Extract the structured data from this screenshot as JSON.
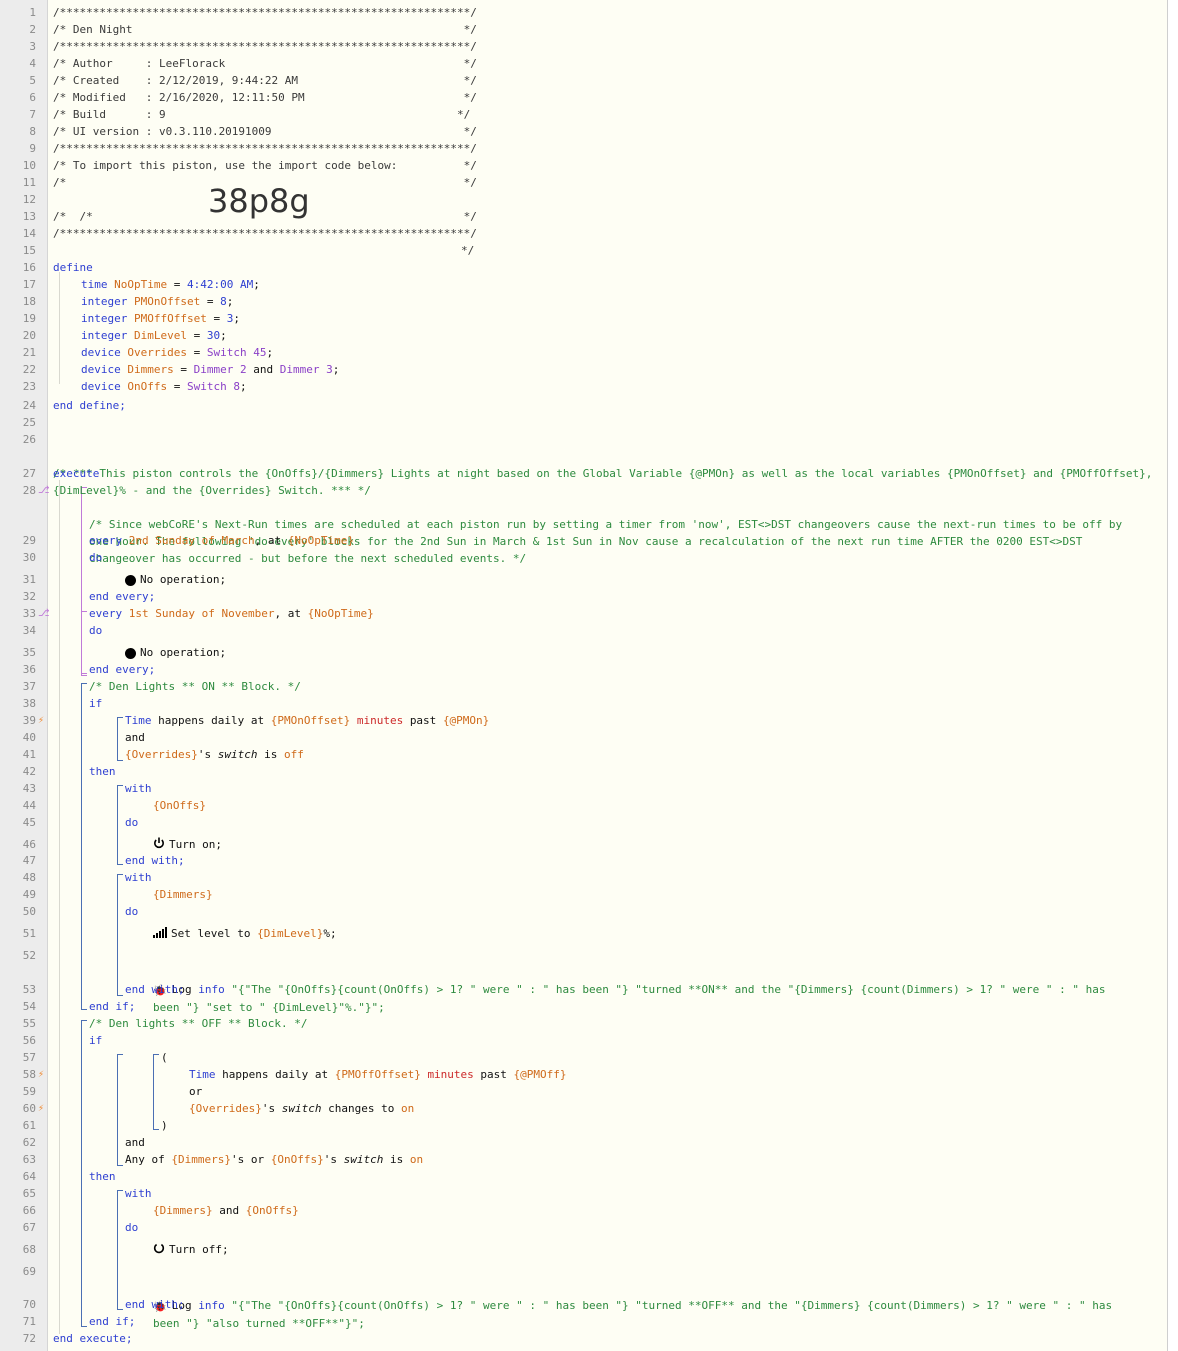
{
  "line_numbers": [
    "1",
    "2",
    "3",
    "4",
    "5",
    "6",
    "7",
    "8",
    "9",
    "10",
    "11",
    "12",
    "13",
    "14",
    "15",
    "16",
    "17",
    "18",
    "19",
    "20",
    "21",
    "22",
    "23",
    "24",
    "25",
    "26",
    "27",
    "28",
    "29",
    "30",
    "31",
    "32",
    "33",
    "34",
    "35",
    "36",
    "37",
    "38",
    "39",
    "40",
    "41",
    "42",
    "43",
    "44",
    "45",
    "46",
    "47",
    "48",
    "49",
    "50",
    "51",
    "52",
    "53",
    "54",
    "55",
    "56",
    "57",
    "58",
    "59",
    "60",
    "61",
    "62",
    "63",
    "64",
    "65",
    "66",
    "67",
    "68",
    "69",
    "70",
    "71",
    "72"
  ],
  "header": {
    "stars": "/**************************************************************/",
    "title_line": "/* Den Night                                                  */",
    "author_line": "/* Author     : LeeFlorack                                    */",
    "created_line": "/* Created    : 2/12/2019, 9:44:22 AM                         */",
    "modified_line": "/* Modified   : 2/16/2020, 12:11:50 PM                        */",
    "build_line": "/* Build      : 9                                            */",
    "ui_version_line": "/* UI version : v0.3.110.20191009                             */",
    "import_line": "/* To import this piston, use the import code below:          */",
    "blank_line": "/*                                                            */",
    "code_prefix": "/*",
    "code_suffix": "*/",
    "import_code": "38p8g"
  },
  "define": {
    "open": "define",
    "close": "end define;",
    "vars": [
      {
        "type": "time",
        "name": "NoOpTime",
        "value": "4:42:00 AM"
      },
      {
        "type": "integer",
        "name": "PMOnOffset",
        "value": "8"
      },
      {
        "type": "integer",
        "name": "PMOffOffset",
        "value": "3"
      },
      {
        "type": "integer",
        "name": "DimLevel",
        "value": "30"
      },
      {
        "type": "device",
        "name": "Overrides",
        "value": "Switch 45"
      },
      {
        "type": "device",
        "name": "Dimmers",
        "value": "Dimmer 2",
        "value2": "Dimmer 3"
      },
      {
        "type": "device",
        "name": "OnOffs",
        "value": "Switch 8"
      }
    ],
    "and_word": "and"
  },
  "comment_main": "/* *** This piston controls the {OnOffs}/{Dimmers} Lights at night based on the Global Variable {@PMOn} as well as the local variables {PMOnOffset} and {PMOffOffset}, {DimLevel}% - and the {Overrides} Switch. *** */",
  "execute": "execute",
  "end_execute": "end execute;",
  "comment_every": "/* Since webCoRE's Next-Run times are scheduled at each piston run by setting a timer from 'now', EST<>DST changeovers cause the next-run times to be off by one hour. The following 'do-every' blocks for the 2nd Sun in March & 1st Sun in Nov cause a recalculation of the next run time AFTER the 0200 EST<>DST changeover has occurred - but before the next scheduled events. */",
  "every1": {
    "kw": "every",
    "when": "2nd Sunday of March",
    "at": ", at",
    "var": "{NoOpTime}"
  },
  "every2": {
    "kw": "every",
    "when": "1st Sunday of November",
    "at": ", at",
    "var": "{NoOpTime}"
  },
  "do": "do",
  "noop": "No operation;",
  "end_every": "end every;",
  "comment_on": "/* Den Lights ** ON ** Block. */",
  "comment_off": "/* Den lights ** OFF ** Block. */",
  "if": "if",
  "then": "then",
  "and": "and",
  "or": "or",
  "end_if": "end if;",
  "with": "with",
  "end_with": "end with;",
  "cond_time_on": {
    "kw": "Time",
    "mid": "happens daily at",
    "var": "{PMOnOffset}",
    "unit": "minutes",
    "past": "past",
    "gvar": "{@PMOn}"
  },
  "cond_override_off": {
    "var": "{Overrides}",
    "poss": "'s",
    "attr": "switch",
    "is": "is",
    "val": "off"
  },
  "cond_time_off": {
    "kw": "Time",
    "mid": "happens daily at",
    "var": "{PMOffOffset}",
    "unit": "minutes",
    "past": "past",
    "gvar": "{@PMOff}"
  },
  "cond_override_on": {
    "var": "{Overrides}",
    "poss": "'s",
    "attr": "switch",
    "changes": "changes to",
    "val": "on"
  },
  "cond_any": {
    "any": "Any of",
    "d": "{Dimmers}",
    "poss": "'s or",
    "o": "{OnOffs}",
    "poss2": "'s",
    "attr": "switch",
    "is": "is",
    "val": "on"
  },
  "paren_open": "(",
  "paren_close": ")",
  "dev_onoffs": "{OnOffs}",
  "dev_dimmers": "{Dimmers}",
  "dev_both_a": "{Dimmers}",
  "dev_both_and": "and",
  "dev_both_b": "{OnOffs}",
  "turn_on": "Turn on;",
  "turn_off": "Turn off;",
  "set_level": {
    "txt": "Set level to",
    "var": "{DimLevel}",
    "end": "%;"
  },
  "log": "Log",
  "info": "info",
  "log_on": "\"{\"The \"{OnOffs}{count(OnOffs) > 1? \" were \" : \" has been \"} \"turned **ON** and the \"{Dimmers} {count(Dimmers) > 1? \" were \" : \" has been \"} \"set to \" {DimLevel}\"%.\"}\";",
  "log_off": "\"{\"The \"{OnOffs}{count(OnOffs) > 1? \" were \" : \" has been \"} \"turned **OFF** and the \"{Dimmers} {count(Dimmers) > 1? \" were \" : \" has been \"} \"also turned **OFF**\"}\";",
  "icons": {
    "noop": "filled-circle-icon",
    "power": "power-icon",
    "level": "signal-bars-icon",
    "log": "bug-icon",
    "trigger": "lightning-bolt-icon",
    "timer": "fork-icon"
  }
}
